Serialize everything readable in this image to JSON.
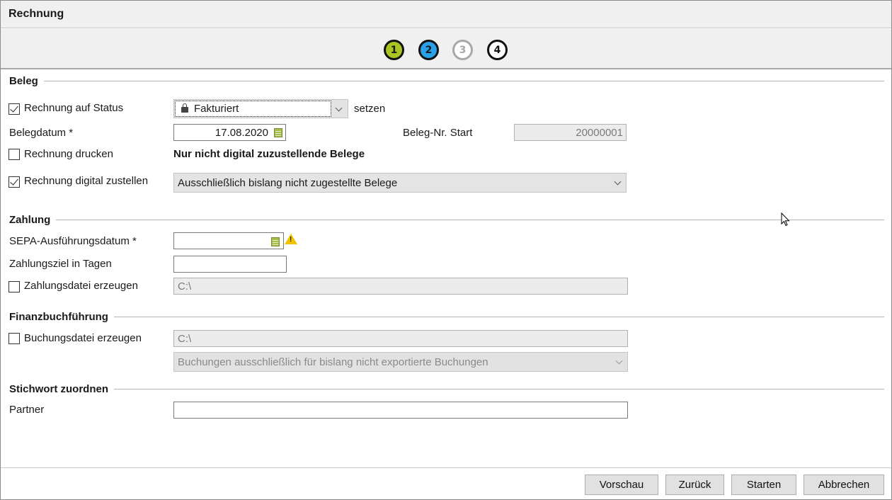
{
  "window": {
    "title": "Rechnung"
  },
  "steps": [
    "1",
    "2",
    "3",
    "4"
  ],
  "beleg": {
    "section_title": "Beleg",
    "status_checkbox_label": "Rechnung auf Status",
    "status_value": "Fakturiert",
    "status_suffix": "setzen",
    "belegdatum_label": "Belegdatum *",
    "belegdatum_value": "17.08.2020",
    "beleg_nr_label": "Beleg-Nr. Start",
    "beleg_nr_value": "20000001",
    "drucken_label": "Rechnung drucken",
    "drucken_note": "Nur nicht digital zuzustellende Belege",
    "digital_label": "Rechnung digital zustellen",
    "digital_value": "Ausschließlich bislang nicht zugestellte Belege"
  },
  "zahlung": {
    "section_title": "Zahlung",
    "sepa_label": "SEPA-Ausführungsdatum *",
    "sepa_value": "",
    "ziel_label": "Zahlungsziel in Tagen",
    "ziel_value": "",
    "datei_label": "Zahlungsdatei erzeugen",
    "datei_value": "C:\\"
  },
  "finanz": {
    "section_title": "Finanzbuchführung",
    "buchung_label": "Buchungsdatei erzeugen",
    "buchung_path": "C:\\",
    "buchung_option": "Buchungen ausschließlich für bislang nicht exportierte Buchungen"
  },
  "stichwort": {
    "section_title": "Stichwort zuordnen",
    "partner_label": "Partner",
    "partner_value": ""
  },
  "buttons": {
    "preview": "Vorschau",
    "back": "Zurück",
    "start": "Starten",
    "cancel": "Abbrechen"
  },
  "checkbox_state": {
    "status": true,
    "drucken": false,
    "digital": true,
    "zahlungsdatei": false,
    "buchungsdatei": false
  },
  "colors": {
    "step1": "#a9c522",
    "step2": "#2aa1e6",
    "warning": "#f2c200"
  }
}
